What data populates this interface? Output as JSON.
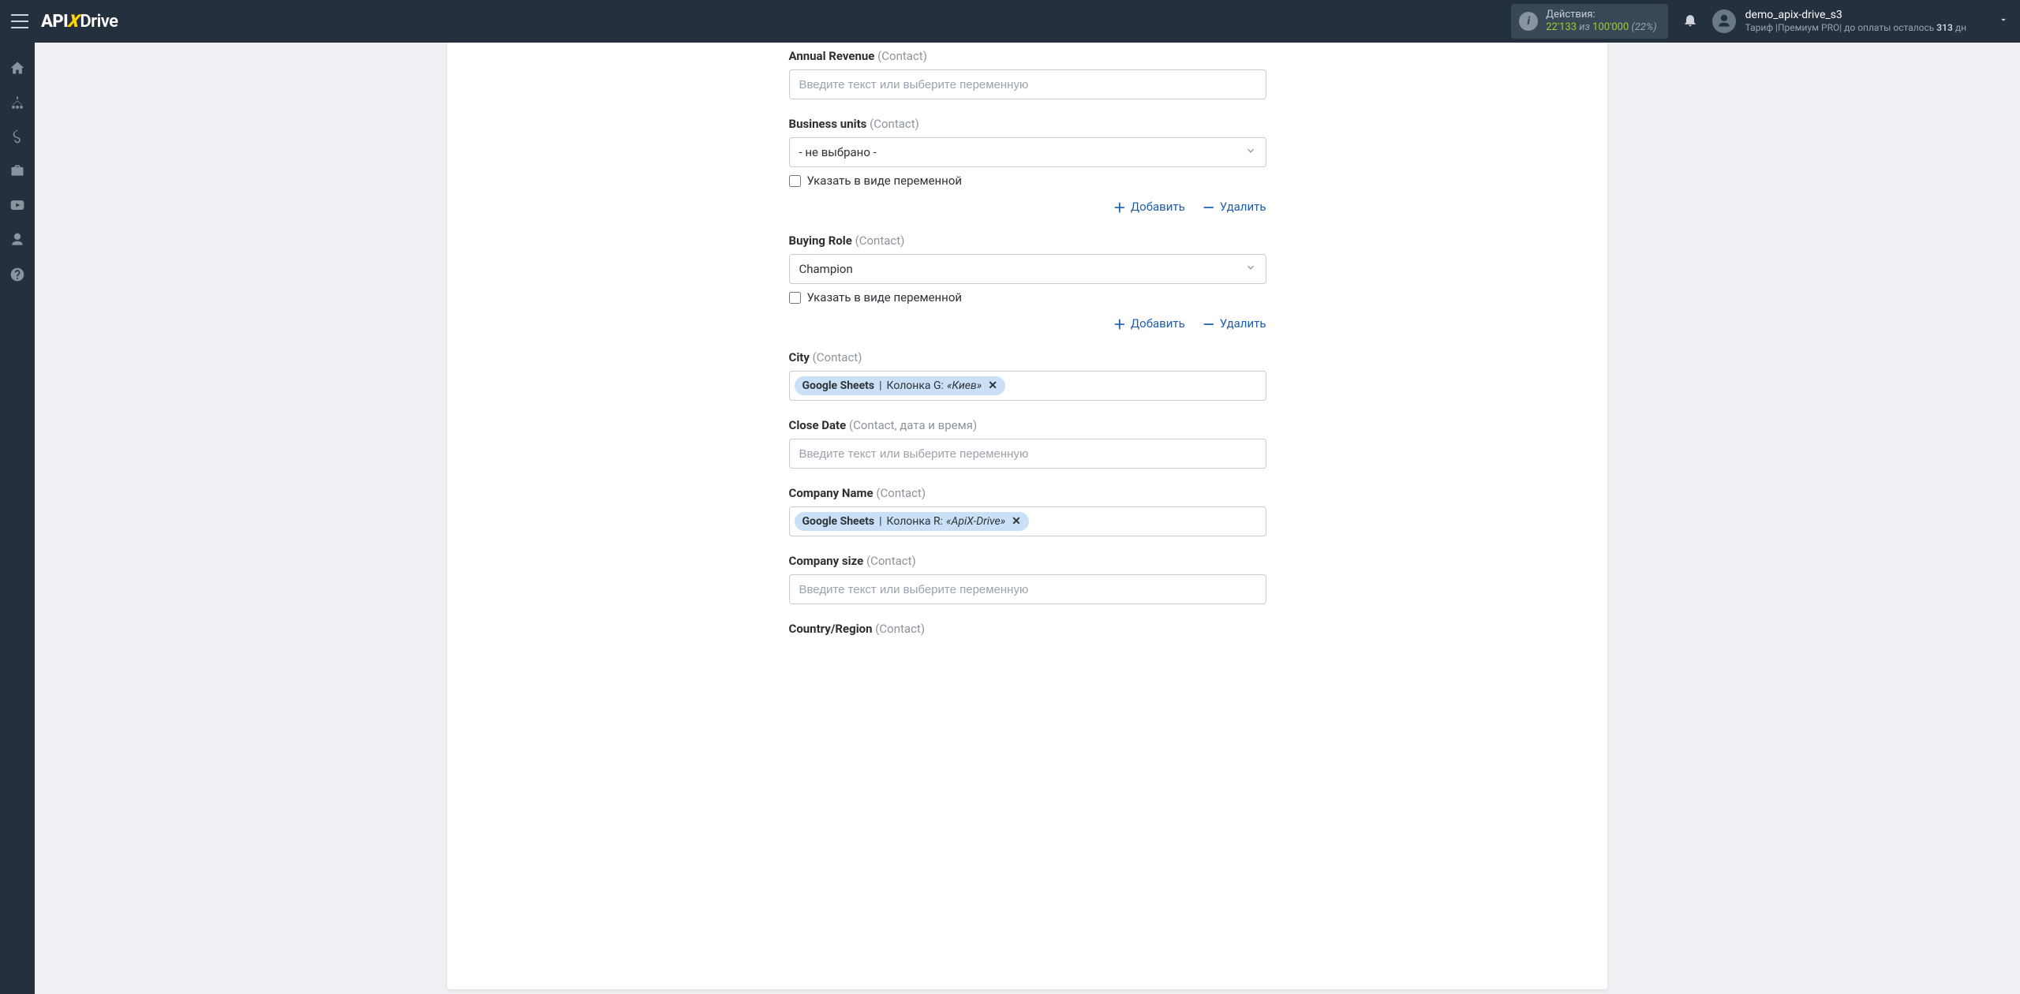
{
  "topbar": {
    "actions_label": "Действия:",
    "actions_count": "22'133",
    "actions_of": "из",
    "actions_total": "100'000",
    "actions_pct": "(22%)",
    "username": "demo_apix-drive_s3",
    "tariff_prefix": "Тариф |",
    "tariff_name": "Премиум PRO",
    "tariff_sep": "| до оплаты осталось ",
    "days_left": "313",
    "days_unit": " дн"
  },
  "common": {
    "placeholder": "Введите текст или выберите переменную",
    "not_selected": "- не выбрано -",
    "as_variable": "Указать в виде переменной",
    "add": "Добавить",
    "delete": "Удалить"
  },
  "fields": {
    "annual_revenue": {
      "name": "Annual Revenue",
      "suffix": "(Contact)"
    },
    "business_units": {
      "name": "Business units",
      "suffix": "(Contact)"
    },
    "buying_role": {
      "name": "Buying Role",
      "suffix": "(Contact)",
      "value": "Champion"
    },
    "city": {
      "name": "City",
      "suffix": "(Contact)",
      "tag": {
        "source": "Google Sheets",
        "column_prefix": "Колонка G:",
        "value": "«Киев»"
      }
    },
    "close_date": {
      "name": "Close Date",
      "suffix": "(Contact, дата и время)"
    },
    "company_name": {
      "name": "Company Name",
      "suffix": "(Contact)",
      "tag": {
        "source": "Google Sheets",
        "column_prefix": "Колонка R:",
        "value": "«ApiX-Drive»"
      }
    },
    "company_size": {
      "name": "Company size",
      "suffix": "(Contact)"
    },
    "country_region": {
      "name": "Country/Region",
      "suffix": "(Contact)"
    }
  }
}
